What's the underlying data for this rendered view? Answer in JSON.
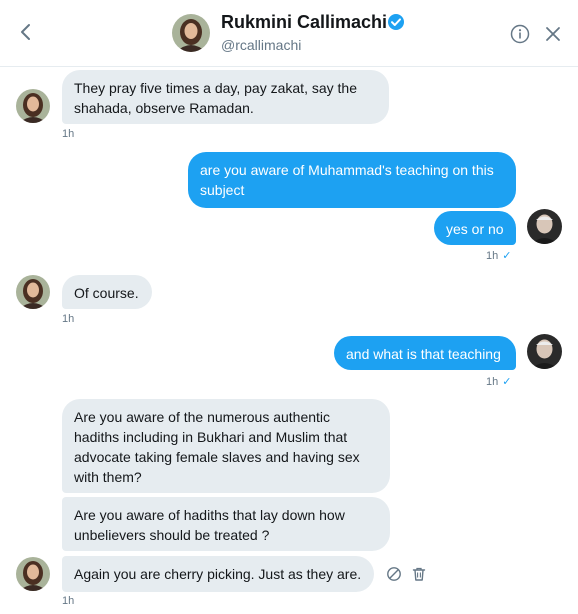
{
  "header": {
    "name": "Rukmini Callimachi",
    "handle": "@rcallimachi",
    "back_icon": "chevron-left-icon",
    "info_icon": "info-icon",
    "close_icon": "close-icon",
    "verified_icon": "verified-badge-icon"
  },
  "colors": {
    "accent": "#1da1f2",
    "incoming_bubble": "#e6ecf0",
    "muted_text": "#657786"
  },
  "messages": [
    {
      "direction": "in",
      "text": "They pray five times a day, pay zakat, say the\nshahada, observe Ramadan.",
      "time": "1h"
    },
    {
      "direction": "out",
      "text": "are you aware of Muhammad's teaching on this\nsubject"
    },
    {
      "direction": "out",
      "text": "yes or no",
      "time": "1h",
      "status": "✓"
    },
    {
      "direction": "in",
      "text": "Of course.",
      "time": "1h"
    },
    {
      "direction": "out",
      "text": "and what is that teaching",
      "time": "1h",
      "status": "✓"
    },
    {
      "direction": "in",
      "text": "Are you aware of the numerous authentic\nhadiths including in Bukhari and Muslim that\nadvocate taking female slaves and having sex\nwith them?"
    },
    {
      "direction": "in",
      "text": "Are you aware of hadiths that lay down how\nunbelievers should be treated ?"
    },
    {
      "direction": "in",
      "text": "Again you are cherry picking. Just as they are.",
      "time": "1h"
    }
  ],
  "message_actions": {
    "report_icon": "report-icon",
    "delete_icon": "trash-icon"
  }
}
